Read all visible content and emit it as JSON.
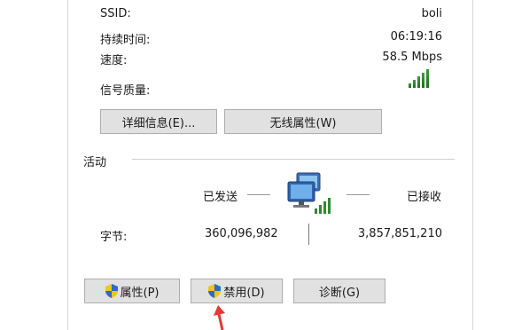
{
  "connection": {
    "ssid_label": "SSID:",
    "ssid_value": "boli",
    "duration_label": "持续时间:",
    "duration_value": "06:19:16",
    "speed_label": "速度:",
    "speed_value": "58.5 Mbps",
    "signal_label": "信号质量:",
    "signal_icon": "signal-strength-icon",
    "signal_level": 5
  },
  "detail_buttons": {
    "details_label": "详细信息(E)...",
    "wireless_props_label": "无线属性(W)"
  },
  "activity": {
    "section_label": "活动",
    "sent_label": "已发送",
    "received_label": "已接收",
    "bytes_label": "字节:",
    "bytes_sent": "360,096,982",
    "bytes_received": "3,857,851,210",
    "network_icon": "network-computers-icon"
  },
  "action_buttons": {
    "properties_label": "属性(P)",
    "disable_label": "禁用(D)",
    "diagnose_label": "诊断(G)",
    "shield_icon": "uac-shield-icon"
  },
  "colors": {
    "signal_green": "#2e8b2e",
    "arrow_red": "#e53935",
    "button_bg": "#e1e1e1"
  }
}
